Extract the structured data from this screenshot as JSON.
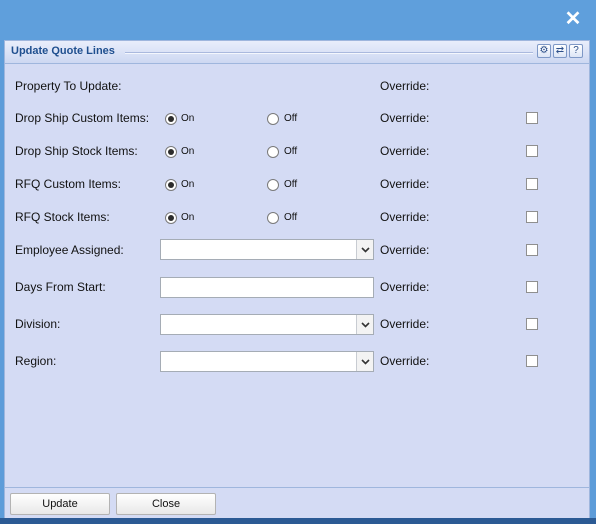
{
  "window": {
    "close_symbol": "✕",
    "title": "Update Quote Lines",
    "tools": [
      {
        "icon": "gear-icon",
        "symbol": "⚙"
      },
      {
        "icon": "refresh-icon",
        "symbol": "⇄"
      },
      {
        "icon": "help-icon",
        "symbol": "?"
      }
    ]
  },
  "header": {
    "property_label": "Property To Update:",
    "override_label": "Override:"
  },
  "rows": [
    {
      "label": "Drop Ship Custom Items:",
      "type": "radio",
      "on_label": "On",
      "off_label": "Off",
      "selected": "On",
      "override_label": "Override:",
      "override_checked": false
    },
    {
      "label": "Drop Ship Stock Items:",
      "type": "radio",
      "on_label": "On",
      "off_label": "Off",
      "selected": "On",
      "override_label": "Override:",
      "override_checked": false
    },
    {
      "label": "RFQ Custom Items:",
      "type": "radio",
      "on_label": "On",
      "off_label": "Off",
      "selected": "On",
      "override_label": "Override:",
      "override_checked": false
    },
    {
      "label": "RFQ Stock Items:",
      "type": "radio",
      "on_label": "On",
      "off_label": "Off",
      "selected": "On",
      "override_label": "Override:",
      "override_checked": false
    },
    {
      "label": "Employee Assigned:",
      "type": "select",
      "value": "",
      "override_label": "Override:",
      "override_checked": false
    },
    {
      "label": "Days From Start:",
      "type": "text",
      "value": "",
      "override_label": "Override:",
      "override_checked": false
    },
    {
      "label": "Division:",
      "type": "select",
      "value": "",
      "override_label": "Override:",
      "override_checked": false
    },
    {
      "label": "Region:",
      "type": "select",
      "value": "",
      "override_label": "Override:",
      "override_checked": false
    }
  ],
  "footer": {
    "update_label": "Update",
    "close_label": "Close"
  }
}
